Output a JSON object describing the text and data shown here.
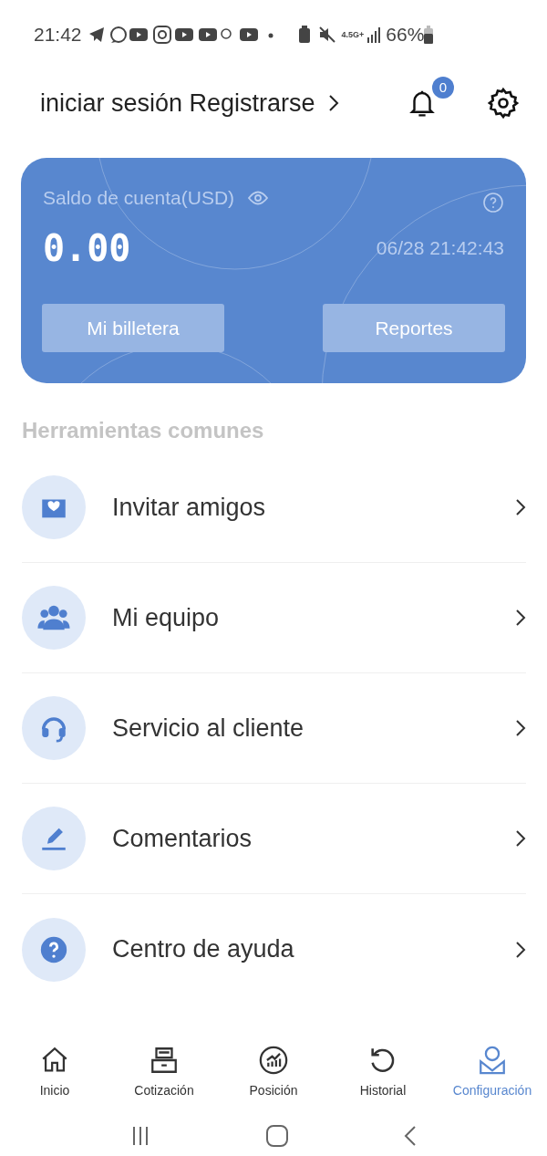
{
  "status_bar": {
    "time": "21:42",
    "network": "4.5G+",
    "battery": "66%"
  },
  "header": {
    "login": "iniciar sesión Registrarse",
    "notifications": "0"
  },
  "account_card": {
    "label": "Saldo de cuenta(USD)",
    "balance": "0.00",
    "timestamp": "06/28 21:42:43",
    "buttons": [
      "Mi billetera",
      "Reportes"
    ]
  },
  "tools": {
    "title": "Herramientas comunes",
    "items": [
      {
        "kind": "invite",
        "label": "Invitar amigos"
      },
      {
        "kind": "team",
        "label": "Mi equipo"
      },
      {
        "kind": "support",
        "label": "Servicio al cliente"
      },
      {
        "kind": "feedback",
        "label": "Comentarios"
      },
      {
        "kind": "help",
        "label": "Centro de ayuda"
      }
    ]
  },
  "bottom_nav": [
    {
      "kind": "home",
      "label": "Inicio",
      "selected": false
    },
    {
      "kind": "quote",
      "label": "Cotización",
      "selected": false
    },
    {
      "kind": "position",
      "label": "Posición",
      "selected": false
    },
    {
      "kind": "history",
      "label": "Historial",
      "selected": false
    },
    {
      "kind": "settings",
      "label": "Configuración",
      "selected": true
    }
  ]
}
